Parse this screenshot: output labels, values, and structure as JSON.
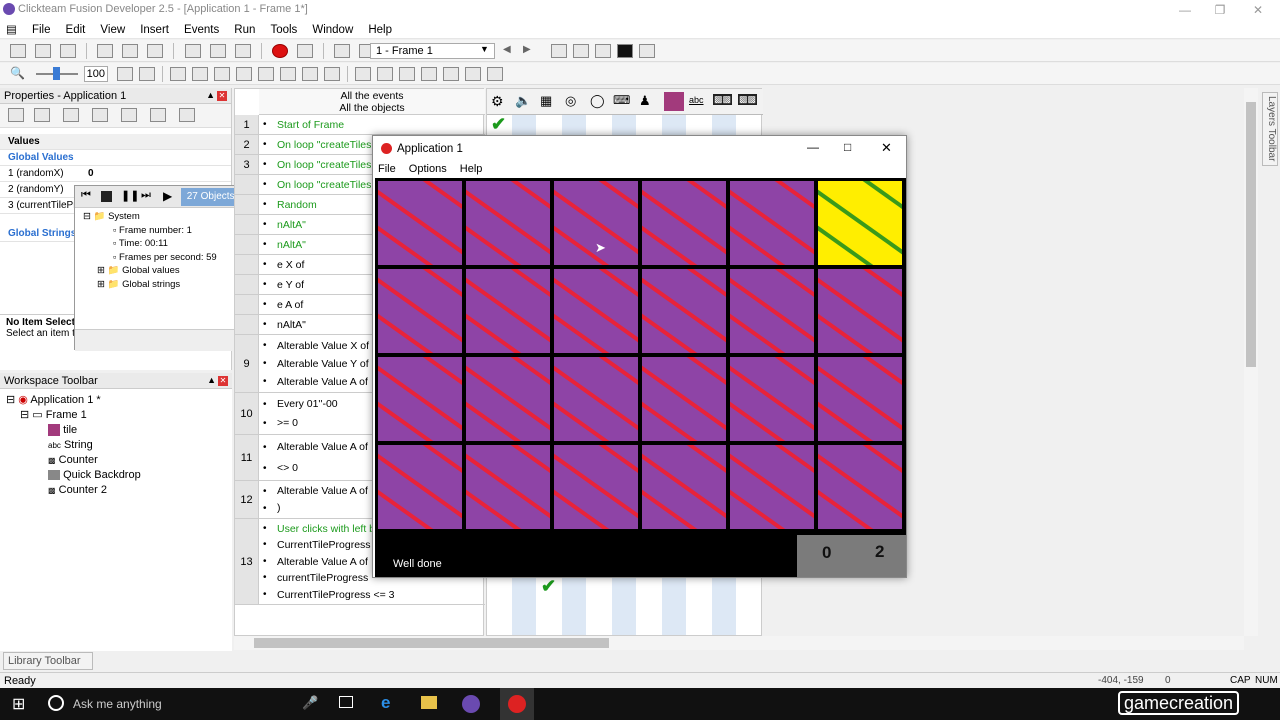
{
  "window": {
    "title": "Clickteam Fusion Developer 2.5 - [Application 1 - Frame 1*]"
  },
  "menu": [
    "File",
    "Edit",
    "View",
    "Insert",
    "Events",
    "Run",
    "Tools",
    "Window",
    "Help"
  ],
  "toolbar": {
    "frame_select": "1 - Frame 1",
    "zoom": "100"
  },
  "properties": {
    "title": "Properties - Application 1",
    "section": "Values",
    "global_values": "Global Values",
    "values": [
      {
        "name": "1 (randomX)",
        "val": "0"
      },
      {
        "name": "2 (randomY)",
        "val": ""
      },
      {
        "name": "3 (currentTilePr",
        "val": ""
      }
    ],
    "global_strings": "Global Strings",
    "no_item": "No Item Selecte",
    "select_hint": "Select an item t"
  },
  "debugger": {
    "status": "27 Objects - 25 Mb",
    "tree": {
      "root": "System",
      "items": [
        "Frame number: 1",
        "Time: 00:11",
        "Frames per second: 59"
      ],
      "folders": [
        "Global values",
        "Global strings"
      ]
    }
  },
  "events": {
    "header1": "All the events",
    "header2": "All the objects",
    "rows": [
      {
        "n": "1",
        "lines": [
          "Start of Frame"
        ]
      },
      {
        "n": "2",
        "lines": [
          "On loop \"createTiles"
        ]
      },
      {
        "n": "3",
        "lines": [
          "On loop \"createTiles"
        ]
      },
      {
        "n": "",
        "lines": [
          "On loop \"createTiles"
        ]
      },
      {
        "n": "",
        "lines": [
          "Random"
        ]
      },
      {
        "n": "",
        "lines": [
          "nAltA\""
        ]
      },
      {
        "n": "",
        "lines": [
          "nAltA\""
        ]
      },
      {
        "n": "",
        "lines": [
          "e X of"
        ]
      },
      {
        "n": "",
        "lines": [
          "e Y of"
        ]
      },
      {
        "n": "",
        "lines": [
          "e A of"
        ]
      },
      {
        "n": "",
        "lines": [
          "nAltA\""
        ]
      },
      {
        "n": "9",
        "lines": [
          "Alterable Value X of",
          "Alterable Value Y of",
          "Alterable Value A of"
        ]
      },
      {
        "n": "10",
        "lines": [
          "Every 01''-00",
          ">= 0"
        ]
      },
      {
        "n": "11",
        "lines": [
          "Alterable Value A of",
          "<> 0"
        ]
      },
      {
        "n": "12",
        "lines": [
          "Alterable Value A of",
          ")"
        ]
      },
      {
        "n": "13",
        "lines": [
          "User clicks with left b",
          "CurrentTileProgress",
          "Alterable Value A of",
          "currentTileProgress",
          "CurrentTileProgress <= 3"
        ]
      }
    ]
  },
  "app": {
    "title": "Application 1",
    "menu": [
      "File",
      "Options",
      "Help"
    ],
    "message": "Well done",
    "counter1": "0",
    "counter2": "2"
  },
  "workspace": {
    "title": "Workspace Toolbar",
    "app": "Application 1 *",
    "frame": "Frame 1",
    "objects": [
      "tile",
      "String",
      "Counter",
      "Quick Backdrop",
      "Counter 2"
    ]
  },
  "library": "Library Toolbar",
  "layers": "Layers Toolbar",
  "status": {
    "left": "Ready",
    "coords": "-404, -159",
    "zero": "0",
    "cap": "CAP",
    "num": "NUM"
  },
  "taskbar": {
    "search": "Ask me anything",
    "brand": "gamecreation"
  },
  "colors": {
    "tile": "#8e44a6",
    "stripe": "#e8233a",
    "yellow": "#ffee00",
    "yellow_stripe": "#3a9a1a"
  }
}
